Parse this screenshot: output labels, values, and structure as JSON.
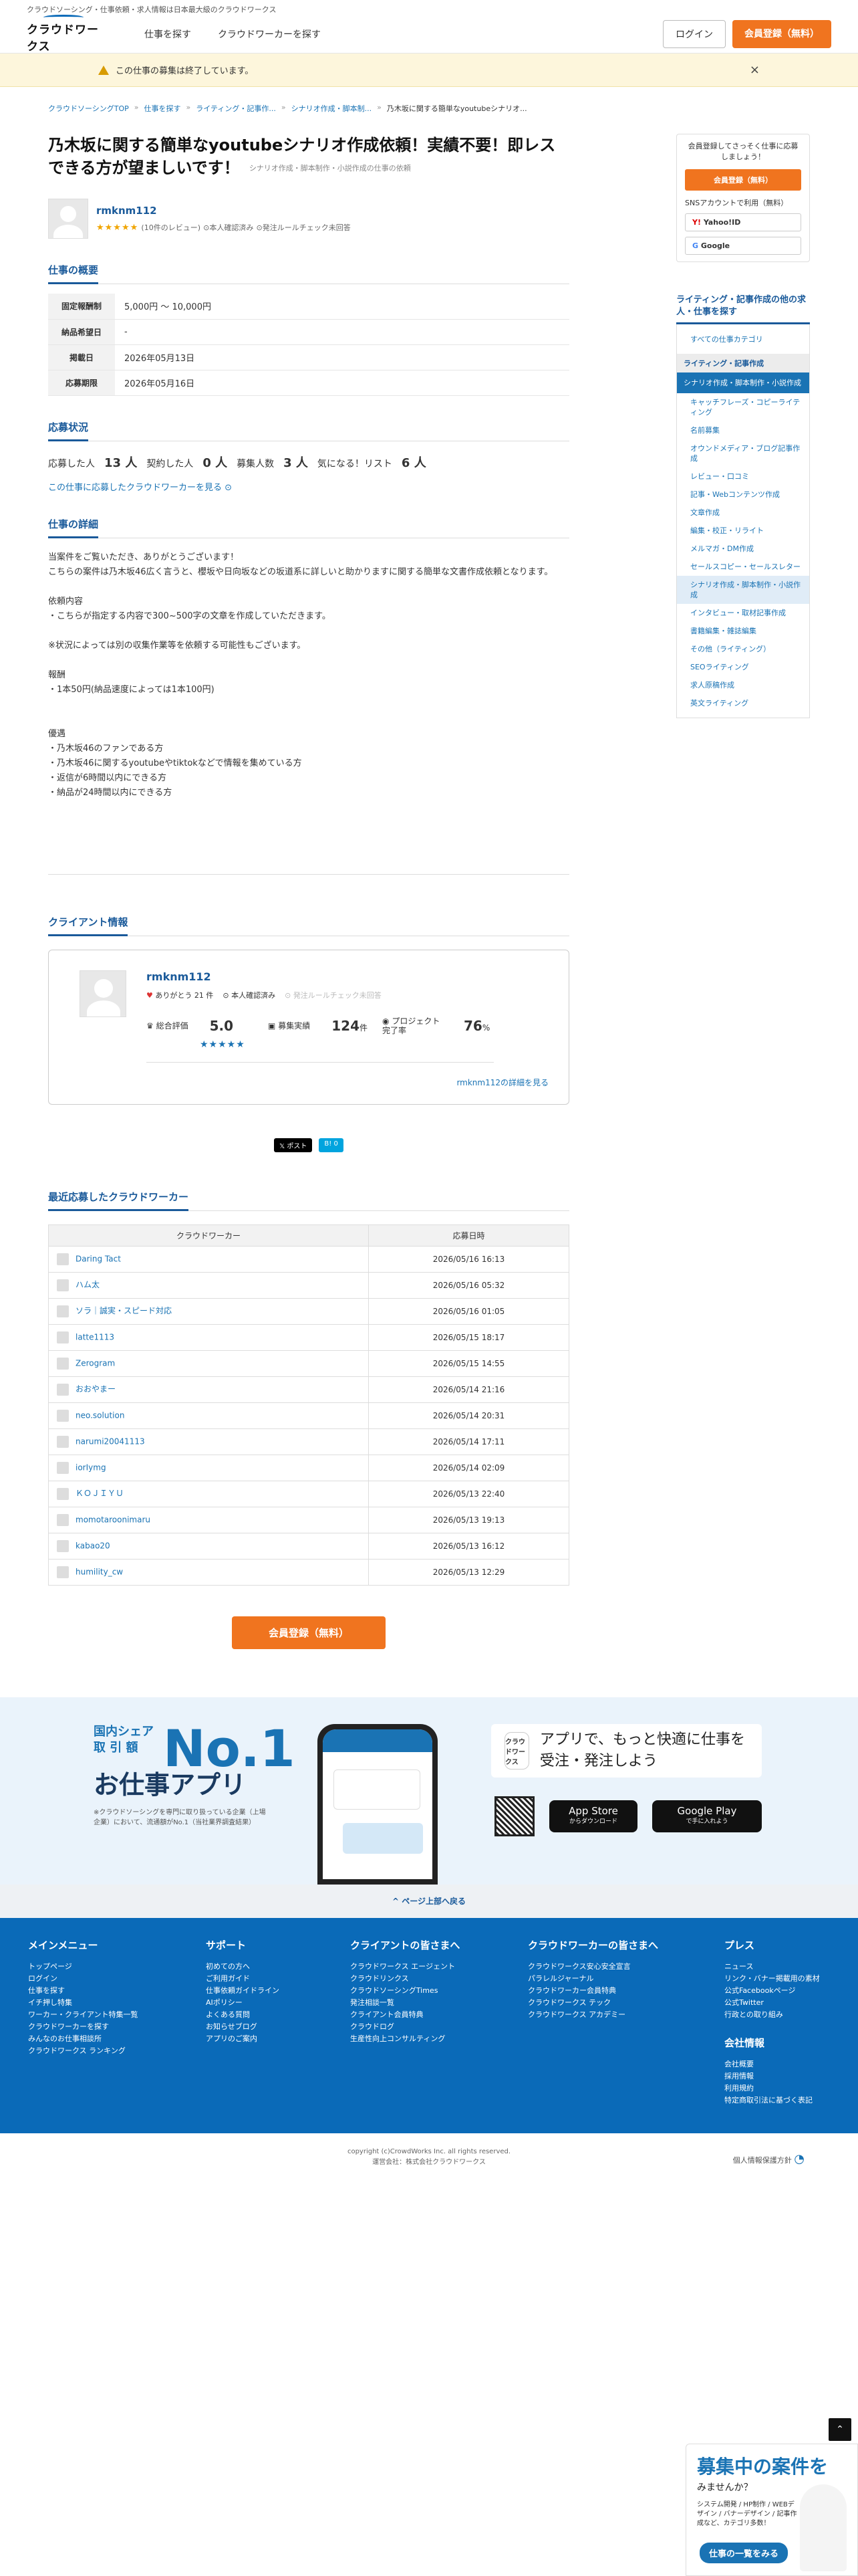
{
  "top_strip": "クラウドソーシング・仕事依頼・求人情報は日本最大級のクラウドワークス",
  "header": {
    "logo_text": "クラウドワークス",
    "nav": [
      "仕事を探す",
      "クラウドワーカーを探す"
    ],
    "login": "ログイン",
    "register": "会員登録（無料）"
  },
  "alert": {
    "text": "この仕事の募集は終了しています。",
    "close": "×"
  },
  "breadcrumbs": [
    "クラウドソーシングTOP",
    "仕事を探す",
    "ライティング・記事作...",
    "シナリオ作成・脚本制...",
    "乃木坂に関する簡単なyoutubeシナリオ..."
  ],
  "job": {
    "title": "乃木坂に関する簡単なyoutubeシナリオ作成依頼！実績不要！即レスできる方が望ましいです！",
    "category": "シナリオ作成・脚本制作・小説作成の仕事の依頼",
    "client": {
      "name": "rmknm112",
      "stars": "★★★★★",
      "reviews": "(10件のレビュー)",
      "verified": "本人確認済み",
      "rule": "発注ルールチェック未回答"
    }
  },
  "overview": {
    "heading": "仕事の概要",
    "rows": [
      {
        "k": "固定報酬制",
        "v": "5,000円 〜 10,000円"
      },
      {
        "k": "納品希望日",
        "v": "-"
      },
      {
        "k": "掲載日",
        "v": "2026年05月13日"
      },
      {
        "k": "応募期限",
        "v": "2026年05月16日"
      }
    ]
  },
  "status": {
    "heading": "応募状況",
    "items": [
      {
        "label": "応募した人",
        "value": "13 人"
      },
      {
        "label": "契約した人",
        "value": "0 人"
      },
      {
        "label": "募集人数",
        "value": "3 人"
      },
      {
        "label": "気になる！リスト",
        "value": "6 人"
      }
    ],
    "link": "この仕事に応募したクラウドワーカーを見る"
  },
  "detail": {
    "heading": "仕事の詳細",
    "body": "当案件をご覧いただき、ありがとうございます！\nこちらの案件は乃木坂46広く言うと、櫻坂や日向坂などの坂道系に詳しいと助かりますに関する簡単な文書作成依頼となります。\n\n依頼内容\n・こちらが指定する内容で300~500字の文章を作成していただきます。\n\n※状況によっては別の収集作業等を依頼する可能性もございます。\n\n報酬\n・1本50円(納品速度によっては1本100円)\n\n\n優遇\n・乃木坂46のファンである方\n・乃木坂46に関するyoutubeやtiktokなどで情報を集めている方\n・返信が6時間以内にできる方\n・納品が24時間以内にできる方"
  },
  "client_info": {
    "heading": "クライアント情報",
    "name": "rmknm112",
    "thanks": "ありがとう 21 件",
    "verified": "本人確認済み",
    "rule": "発注ルールチェック未回答",
    "rating_label": "総合評価",
    "rating": "5.0",
    "rating_stars": "★★★★★",
    "orders_label": "募集実績",
    "orders": "124",
    "orders_unit": "件",
    "completion_label": "プロジェクト完了率",
    "completion": "76",
    "completion_unit": "%",
    "more": "rmknm112の詳細を見る"
  },
  "share": {
    "post": "𝕏 ポスト",
    "hatena": "B! 0"
  },
  "recent": {
    "heading": "最近応募したクラウドワーカー",
    "col_worker": "クラウドワーカー",
    "col_date": "応募日時",
    "rows": [
      {
        "name": "Daring Tact",
        "date": "2026/05/16 16:13"
      },
      {
        "name": "ハム太",
        "date": "2026/05/16 05:32"
      },
      {
        "name": "ソラ｜誠実・スピード対応",
        "date": "2026/05/16 01:05"
      },
      {
        "name": "latte1113",
        "date": "2026/05/15 18:17"
      },
      {
        "name": "Zerogram",
        "date": "2026/05/15 14:55"
      },
      {
        "name": "おおやまー",
        "date": "2026/05/14 21:16"
      },
      {
        "name": "neo.solution",
        "date": "2026/05/14 20:31"
      },
      {
        "name": "narumi20041113",
        "date": "2026/05/14 17:11"
      },
      {
        "name": "iorIymg",
        "date": "2026/05/14 02:09"
      },
      {
        "name": "ＫＯＪＩＹＵ",
        "date": "2026/05/13 22:40"
      },
      {
        "name": "momotaroonimaru",
        "date": "2026/05/13 19:13"
      },
      {
        "name": "kabao20",
        "date": "2026/05/13 16:12"
      },
      {
        "name": "humility_cw",
        "date": "2026/05/13 12:29"
      }
    ],
    "cta": "会員登録（無料）"
  },
  "sidebar": {
    "lead": "会員登録してさっそく仕事に応募しましょう！",
    "register": "会員登録（無料）",
    "sns_label": "SNSアカウントで利用（無料）",
    "yahoo": "Yahoo!ID",
    "google": "Google",
    "cat_heading": "ライティング・記事作成の他の求人・仕事を探す",
    "all": "すべての仕事カテゴリ",
    "group": "ライティング・記事作成",
    "selected": "シナリオ作成・脚本制作・小説作成",
    "items": [
      "キャッチフレーズ・コピーライティング",
      "名前募集",
      "オウンドメディア・ブログ記事作成",
      "レビュー・口コミ",
      "記事・Webコンテンツ作成",
      "文章作成",
      "編集・校正・リライト",
      "メルマガ・DM作成",
      "セールスコピー・セールスレター",
      "シナリオ作成・脚本制作・小説作成",
      "インタビュー・取材記事作成",
      "書籍編集・雑誌編集",
      "その他（ライティング）",
      "SEOライティング",
      "求人原稿作成",
      "英文ライティング"
    ]
  },
  "banner": {
    "small1": "国内シェア",
    "small2": "取 引 額",
    "no1": "No.1",
    "app": "お仕事アプリ",
    "note": "※クラウドソーシングを専門に取り扱っている企業（上場企業）において、流通額がNo.1（当社業界調査結果）",
    "icon": "クラウドワークス",
    "message": "アプリで、もっと快適に仕事を受注・発注しよう",
    "appstore": "App Store",
    "appstore_sub": "からダウンロード",
    "googleplay": "Google Play",
    "googleplay_sub": "で手に入れよう"
  },
  "pagetop": "^ ページ上部へ戻る",
  "footer": {
    "cols": [
      {
        "h": "メインメニュー",
        "items": [
          "トップページ",
          "ログイン",
          "仕事を探す",
          "イチ押し特集",
          "ワーカー・クライアント特集一覧",
          "クラウドワーカーを探す",
          "みんなのお仕事相談所",
          "クラウドワークス ランキング"
        ]
      },
      {
        "h": "サポート",
        "items": [
          "初めての方へ",
          "ご利用ガイド",
          "仕事依頼ガイドライン",
          "AIポリシー",
          "よくある質問",
          "お知らせブログ",
          "アプリのご案内"
        ]
      },
      {
        "h": "クライアントの皆さまへ",
        "items": [
          "クラウドワークス エージェント",
          "クラウドリンクス",
          "クラウドソーシングTimes",
          "発注相談一覧",
          "クライアント会員特典",
          "クラウドログ",
          "生産性向上コンサルティング"
        ]
      },
      {
        "h": "クラウドワーカーの皆さまへ",
        "items": [
          "クラウドワークス安心安全宣言",
          "パラレルジャーナル",
          "クラウドワーカー会員特典",
          "クラウドワークス テック",
          "クラウドワークス アカデミー"
        ]
      },
      {
        "h": "プレス",
        "items": [
          "ニュース",
          "リンク・バナー掲載用の素材",
          "公式Facebookページ",
          "公式Twitter",
          "行政との取り組み"
        ],
        "h2": "会社情報",
        "items2": [
          "会社概要",
          "採用情報",
          "利用規約",
          "特定商取引法に基づく表記"
        ]
      }
    ]
  },
  "bottom": {
    "copy": "copyright (c)CrowdWorks Inc. all rights reserved.",
    "company": "運営会社：株式会社クラウドワークス",
    "privacy": "個人情報保護方針"
  },
  "ad": {
    "t1": "募集中の案件を",
    "t2": "みませんか？",
    "t3": "システム開発 / HP制作 / WEBデザイン / バナーデザイン / 記事作成など、カテゴリ多数！",
    "button": "仕事の一覧をみる"
  },
  "colors": {
    "accent": "#f0741f",
    "brand": "#0a6ab8"
  }
}
